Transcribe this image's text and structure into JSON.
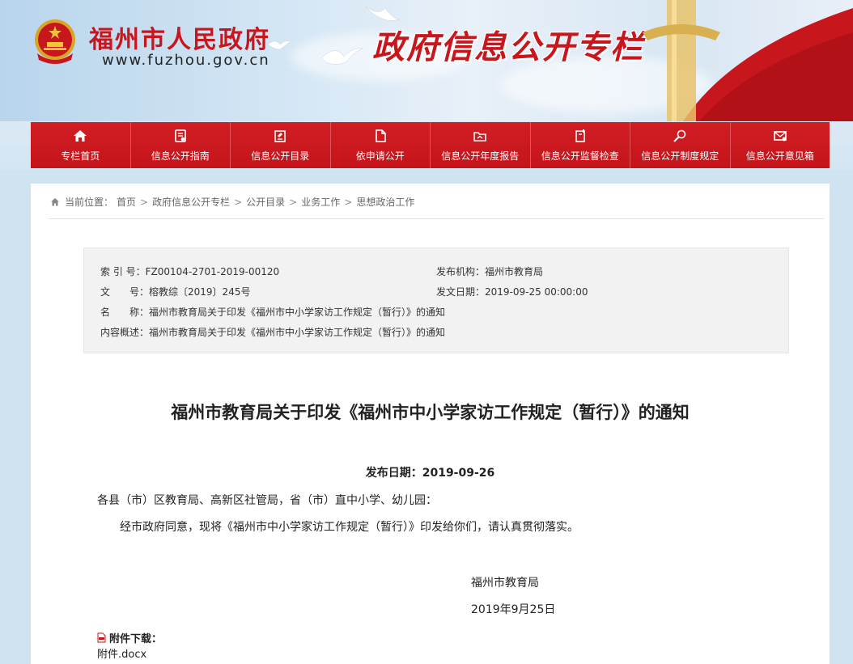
{
  "header": {
    "site_name": "福州市人民政府",
    "site_url": "www.fuzhou.gov.cn",
    "column_title": "政府信息公开专栏"
  },
  "nav": {
    "items": [
      {
        "label": "专栏首页",
        "icon": "home-icon"
      },
      {
        "label": "信息公开指南",
        "icon": "guide-icon"
      },
      {
        "label": "信息公开目录",
        "icon": "catalog-icon"
      },
      {
        "label": "依申请公开",
        "icon": "document-icon"
      },
      {
        "label": "信息公开年度报告",
        "icon": "report-folder-icon"
      },
      {
        "label": "信息公开监督检查",
        "icon": "inspection-icon"
      },
      {
        "label": "信息公开制度规定",
        "icon": "regulation-search-icon"
      },
      {
        "label": "信息公开意见箱",
        "icon": "mailbox-icon"
      }
    ],
    "colors": {
      "bg": "#c9161c",
      "text": "#ffffff"
    }
  },
  "breadcrumb": {
    "prefix": "当前位置：",
    "items": [
      "首页",
      "政府信息公开专栏",
      "公开目录",
      "业务工作",
      "思想政治工作"
    ],
    "separator": ">"
  },
  "meta": {
    "index_label": "索 引 号：",
    "index_value": "FZ00104-2701-2019-00120",
    "publisher_label": "发布机构：",
    "publisher_value": "福州市教育局",
    "docno_label": "文　　号：",
    "docno_value": "榕教综〔2019〕245号",
    "issue_date_label": "发文日期：",
    "issue_date_value": "2019-09-25 00:00:00",
    "name_label": "名　　称：",
    "name_value": "福州市教育局关于印发《福州市中小学家访工作规定（暂行）》的通知",
    "summary_label": "内容概述：",
    "summary_value": "福州市教育局关于印发《福州市中小学家访工作规定（暂行）》的通知"
  },
  "article": {
    "title": "福州市教育局关于印发《福州市中小学家访工作规定（暂行）》的通知",
    "pubdate_label": "发布日期：",
    "pubdate_value": "2019-09-26",
    "salutation": "各县（市）区教育局、高新区社管局，省（市）直中小学、幼儿园：",
    "paragraph": "经市政府同意，现将《福州市中小学家访工作规定（暂行）》印发给你们，请认真贯彻落实。",
    "signature": "福州市教育局",
    "sign_date": "2019年9月25日"
  },
  "attachments": {
    "label": "附件下载：",
    "files": [
      "附件.docx"
    ]
  }
}
